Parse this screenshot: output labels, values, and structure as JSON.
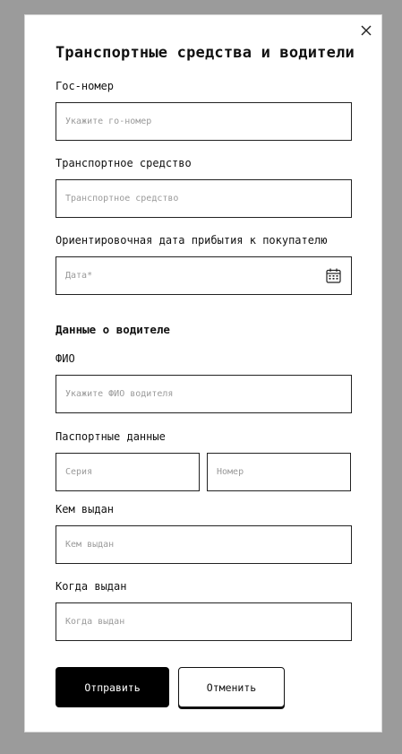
{
  "modal": {
    "title": "Транспортные средства и водители"
  },
  "vehicle": {
    "plate_label": "Гос-номер",
    "plate_placeholder": "Укажите го-номер",
    "vehicle_label": "Транспортное средство",
    "vehicle_placeholder": "Транспортное средство",
    "arrival_label": "Ориентировочная дата прибытия к покупателю",
    "arrival_placeholder": "Дата*"
  },
  "driver": {
    "section_title": "Данные о водителе",
    "name_label": "ФИО",
    "name_placeholder": "Укажите ФИО водителя",
    "passport_label": "Паспортные данные",
    "series_placeholder": "Серия",
    "number_placeholder": "Номер",
    "issued_by_label": "Кем выдан",
    "issued_by_placeholder": "Кем выдан",
    "issued_date_label": "Когда выдан",
    "issued_date_placeholder": "Когда выдан"
  },
  "actions": {
    "submit_label": "Отправить",
    "cancel_label": "Отменить"
  },
  "icons": {
    "close": "close-icon",
    "calendar": "calendar-icon"
  },
  "colors": {
    "overlay": "#9b9b9b",
    "primary_button": "#000000",
    "placeholder": "#9a9a9a"
  }
}
